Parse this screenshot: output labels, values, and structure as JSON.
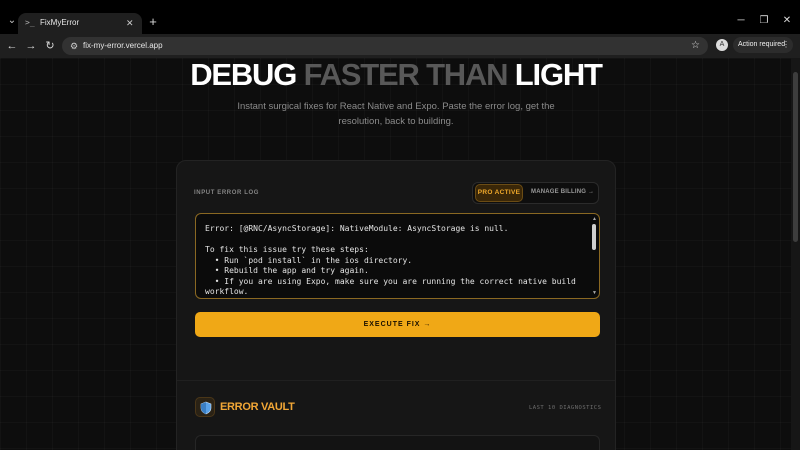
{
  "browser": {
    "tab_title": "FixMyError",
    "tab_favicon": ">_",
    "tab_close": "✕",
    "new_tab": "+",
    "url": "fix-my-error.vercel.app",
    "profile_initial": "A",
    "action_label": "Action required",
    "icons": [
      "tab-search-icon",
      "close-icon",
      "plus-icon",
      "minimize-icon",
      "restore-icon",
      "back-icon",
      "forward-icon",
      "reload-icon",
      "site-info-icon",
      "star-icon",
      "kebab-menu-icon"
    ]
  },
  "hero": {
    "word1": "DEBUG",
    "word2": "FASTER THAN",
    "word3": "LIGHT",
    "subtitle": "Instant surgical fixes for React Native and Expo. Paste the error log, get the resolution, back to building."
  },
  "input_card": {
    "label": "INPUT ERROR LOG",
    "pro_badge": "PRO ACTIVE",
    "billing_link": "MANAGE BILLING →",
    "error_log": "Error: [@RNC/AsyncStorage]: NativeModule: AsyncStorage is null.\n\nTo fix this issue try these steps:\n  • Run `pod install` in the ios directory.\n  • Rebuild the app and try again.\n  • If you are using Expo, make sure you are running the correct native build\nworkflow.",
    "execute_button": "EXECUTE FIX →"
  },
  "vault": {
    "title": "ERROR VAULT",
    "meta": "LAST 10 DIAGNOSTICS",
    "icon": "shield-icon"
  },
  "colors": {
    "accent": "#f0a816",
    "accent_text": "#f2a736",
    "background": "#0d0d0d",
    "card": "#161616"
  }
}
